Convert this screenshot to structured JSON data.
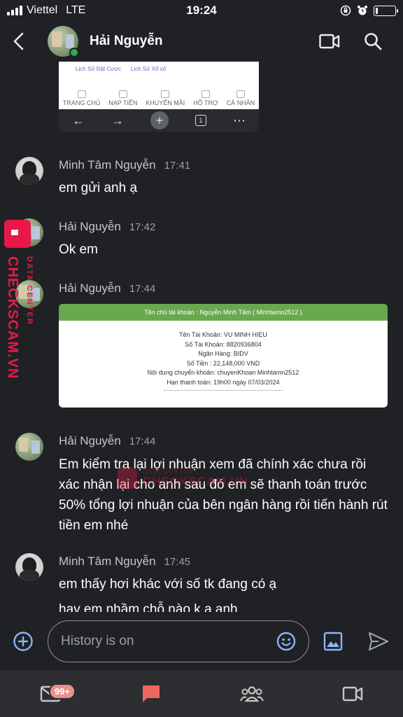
{
  "status_bar": {
    "carrier": "Viettel",
    "network": "LTE",
    "time": "19:24"
  },
  "header": {
    "contact_name": "Hải Nguyễn"
  },
  "shared_screenshot": {
    "top_items": [
      "Lịch Sử Đặt Cược",
      "Lịch Sử Xổ số"
    ],
    "nav_items": [
      "TRANG CHỦ",
      "NẠP TIỀN",
      "KHUYẾN MÃI",
      "HỖ TRỢ",
      "CÁ NHÂN"
    ],
    "tab_count": "1"
  },
  "messages": [
    {
      "sender": "Minh Tâm Nguyễn",
      "time": "17:41",
      "text": "em gửi anh ạ"
    },
    {
      "sender": "Hải Nguyễn",
      "time": "17:42",
      "text": "Ok em"
    },
    {
      "sender": "Hải Nguyễn",
      "time": "17:44",
      "text": ""
    },
    {
      "sender": "Hải Nguyễn",
      "time": "17:44",
      "text": "Em kiểm tra lại lợi nhuận xem đã chính xác chưa rồi xác nhận lại cho anh sau đó em sẽ thanh toán trước 50% tổng lợi nhuận của bên ngân hàng rồi tiến hành rút tiền em nhé"
    },
    {
      "sender": "Minh Tâm Nguyễn",
      "time": "17:45",
      "text": "em thấy hơi khác với số tk đang có ạ"
    },
    {
      "sender": "",
      "time": "",
      "text": "hay em nhầm chỗ nào k a anh"
    }
  ],
  "transfer_image": {
    "header": "Tên chủ tài khoản :  Nguyễn Minh Tâm ( Minhtamn2512 )",
    "lines": [
      "Tên Tài Khoản: VU MINH HIEU",
      "Số Tài Khoản:  8820936804",
      "Ngân Hàng: BIDV",
      "Số Tiền :  22,148,000 VND",
      "Nội dung chuyển khoản: chuyenKhoan  Minhtamn2512",
      "Hạn thanh toán: 19h00 ngày 07/03/2024"
    ]
  },
  "watermark": {
    "brand": "CHECKSCAM.VN",
    "sub": "DATA CENTER"
  },
  "composer": {
    "placeholder": "History is on"
  },
  "bottom_nav": {
    "mail_badge": "99+"
  },
  "colors": {
    "background": "#202124",
    "accent": "#8ab4f8",
    "chat_active": "#ee675c",
    "watermark": "#e8194a"
  }
}
